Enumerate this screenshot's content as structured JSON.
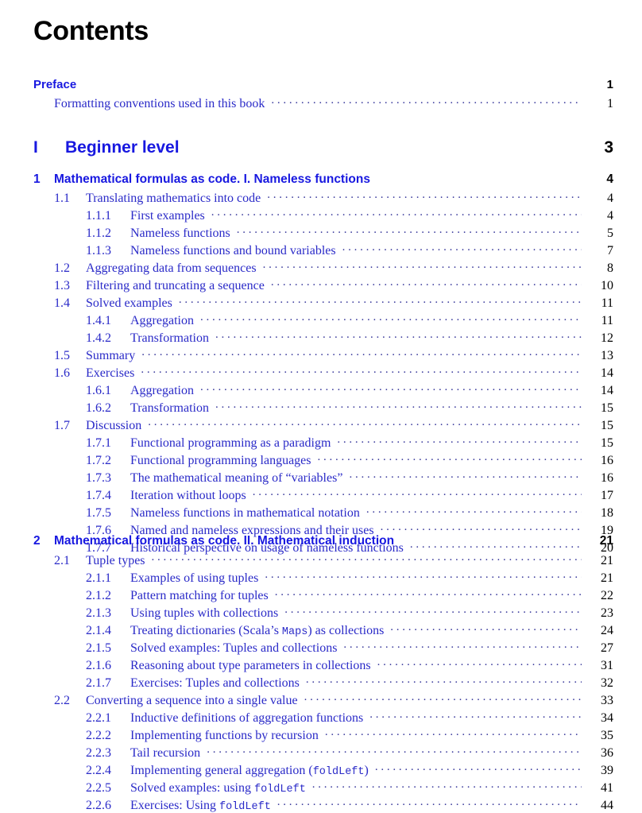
{
  "document": {
    "title": "Contents",
    "title_color": "#000000",
    "link_color": "#2222cc",
    "page_number_color": "#000000"
  },
  "toc": {
    "entries": [
      {
        "level": "frontmatter",
        "number": "",
        "title": "Preface",
        "page": "1",
        "leader": false
      },
      {
        "level": "subfront",
        "number": "",
        "title": "Formatting conventions used in this book",
        "page": "1",
        "leader": true
      },
      {
        "level": "part",
        "number": "I",
        "title": "Beginner level",
        "page": "3",
        "leader": false
      },
      {
        "level": "chapter",
        "number": "1",
        "title": "Mathematical formulas as code. I. Nameless functions",
        "page": "4",
        "leader": false
      },
      {
        "level": "section",
        "number": "1.1",
        "title": "Translating mathematics into code",
        "page": "4",
        "leader": true
      },
      {
        "level": "subsection",
        "number": "1.1.1",
        "title": "First examples",
        "page": "4",
        "leader": true
      },
      {
        "level": "subsection",
        "number": "1.1.2",
        "title": "Nameless functions",
        "page": "5",
        "leader": true
      },
      {
        "level": "subsection",
        "number": "1.1.3",
        "title": "Nameless functions and bound variables",
        "page": "7",
        "leader": true
      },
      {
        "level": "section",
        "number": "1.2",
        "title": "Aggregating data from sequences",
        "page": "8",
        "leader": true
      },
      {
        "level": "section",
        "number": "1.3",
        "title": "Filtering and truncating a sequence",
        "page": "10",
        "leader": true
      },
      {
        "level": "section",
        "number": "1.4",
        "title": "Solved examples",
        "page": "11",
        "leader": true
      },
      {
        "level": "subsection",
        "number": "1.4.1",
        "title": "Aggregation",
        "page": "11",
        "leader": true
      },
      {
        "level": "subsection",
        "number": "1.4.2",
        "title": "Transformation",
        "page": "12",
        "leader": true
      },
      {
        "level": "section",
        "number": "1.5",
        "title": "Summary",
        "page": "13",
        "leader": true
      },
      {
        "level": "section",
        "number": "1.6",
        "title": "Exercises",
        "page": "14",
        "leader": true
      },
      {
        "level": "subsection",
        "number": "1.6.1",
        "title": "Aggregation",
        "page": "14",
        "leader": true
      },
      {
        "level": "subsection",
        "number": "1.6.2",
        "title": "Transformation",
        "page": "15",
        "leader": true
      },
      {
        "level": "section",
        "number": "1.7",
        "title": "Discussion",
        "page": "15",
        "leader": true
      },
      {
        "level": "subsection",
        "number": "1.7.1",
        "title": "Functional programming as a paradigm",
        "page": "15",
        "leader": true
      },
      {
        "level": "subsection",
        "number": "1.7.2",
        "title": "Functional programming languages",
        "page": "16",
        "leader": true
      },
      {
        "level": "subsection",
        "number": "1.7.3",
        "title": "The mathematical meaning of “variables”",
        "page": "16",
        "leader": true
      },
      {
        "level": "subsection",
        "number": "1.7.4",
        "title": "Iteration without loops",
        "page": "17",
        "leader": true
      },
      {
        "level": "subsection",
        "number": "1.7.5",
        "title": "Nameless functions in mathematical notation",
        "page": "18",
        "leader": true
      },
      {
        "level": "subsection",
        "number": "1.7.6",
        "title": "Named and nameless expressions and their uses",
        "page": "19",
        "leader": true
      },
      {
        "level": "subsection",
        "number": "1.7.7",
        "title": "Historical perspective on usage of nameless functions",
        "page": "20",
        "leader": true
      },
      {
        "level": "chapter",
        "number": "2",
        "title": "Mathematical formulas as code. II. Mathematical induction",
        "page": "21",
        "leader": false
      },
      {
        "level": "section",
        "number": "2.1",
        "title": "Tuple types",
        "page": "21",
        "leader": true
      },
      {
        "level": "subsection",
        "number": "2.1.1",
        "title": "Examples of using tuples",
        "page": "21",
        "leader": true
      },
      {
        "level": "subsection",
        "number": "2.1.2",
        "title": "Pattern matching for tuples",
        "page": "22",
        "leader": true
      },
      {
        "level": "subsection",
        "number": "2.1.3",
        "title": "Using tuples with collections",
        "page": "23",
        "leader": true
      },
      {
        "level": "subsection",
        "number": "2.1.4",
        "title_parts": [
          {
            "text": "Treating dictionaries (Scala’s ",
            "mono": false
          },
          {
            "text": "Maps",
            "mono": true
          },
          {
            "text": ") as collections",
            "mono": false
          }
        ],
        "title": "Treating dictionaries (Scala’s Maps) as collections",
        "page": "24",
        "leader": true
      },
      {
        "level": "subsection",
        "number": "2.1.5",
        "title": "Solved examples: Tuples and collections",
        "page": "27",
        "leader": true
      },
      {
        "level": "subsection",
        "number": "2.1.6",
        "title": "Reasoning about type parameters in collections",
        "page": "31",
        "leader": true
      },
      {
        "level": "subsection",
        "number": "2.1.7",
        "title": "Exercises: Tuples and collections",
        "page": "32",
        "leader": true
      },
      {
        "level": "section",
        "number": "2.2",
        "title": "Converting a sequence into a single value",
        "page": "33",
        "leader": true
      },
      {
        "level": "subsection",
        "number": "2.2.1",
        "title": "Inductive definitions of aggregation functions",
        "page": "34",
        "leader": true
      },
      {
        "level": "subsection",
        "number": "2.2.2",
        "title": "Implementing functions by recursion",
        "page": "35",
        "leader": true
      },
      {
        "level": "subsection",
        "number": "2.2.3",
        "title": "Tail recursion",
        "page": "36",
        "leader": true
      },
      {
        "level": "subsection",
        "number": "2.2.4",
        "title_parts": [
          {
            "text": "Implementing general aggregation (",
            "mono": false
          },
          {
            "text": "foldLeft",
            "mono": true
          },
          {
            "text": ")",
            "mono": false
          }
        ],
        "title": "Implementing general aggregation (foldLeft)",
        "page": "39",
        "leader": true
      },
      {
        "level": "subsection",
        "number": "2.2.5",
        "title_parts": [
          {
            "text": "Solved examples: using ",
            "mono": false
          },
          {
            "text": "foldLeft",
            "mono": true
          }
        ],
        "title": "Solved examples: using foldLeft",
        "page": "41",
        "leader": true
      },
      {
        "level": "subsection",
        "number": "2.2.6",
        "title_parts": [
          {
            "text": "Exercises: Using ",
            "mono": false
          },
          {
            "text": "foldLeft",
            "mono": true
          }
        ],
        "title": "Exercises: Using foldLeft",
        "page": "44",
        "leader": true
      }
    ]
  },
  "layout": {
    "row_tops": [
      96,
      120,
      172,
      214,
      238,
      260,
      282,
      304,
      326,
      348,
      370,
      392,
      414,
      436,
      458,
      480,
      502,
      524,
      546,
      568,
      590,
      612,
      634,
      656,
      672,
      698,
      720,
      742,
      764,
      786,
      808,
      830,
      852,
      874,
      896,
      918,
      940,
      962,
      984
    ]
  }
}
